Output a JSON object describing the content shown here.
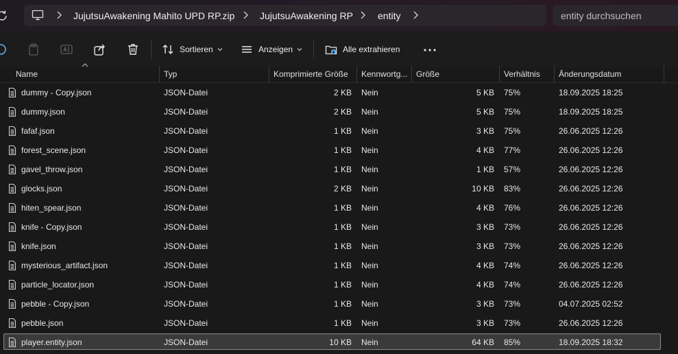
{
  "breadcrumb": {
    "items": [
      "JujutsuAwakening Mahito UPD RP.zip",
      "JujutsuAwakening RP",
      "entity"
    ]
  },
  "search": {
    "placeholder": "entity durchsuchen"
  },
  "toolbar": {
    "sort_label": "Sortieren",
    "view_label": "Anzeigen",
    "extract_label": "Alle extrahieren"
  },
  "columns": [
    "Name",
    "Typ",
    "Komprimierte Größe",
    "Kennwortg...",
    "Größe",
    "Verhältnis",
    "Änderungsdatum"
  ],
  "files": [
    {
      "name": "dummy - Copy.json",
      "type": "JSON-Datei",
      "compressed": "2 KB",
      "password": "Nein",
      "size": "5 KB",
      "ratio": "75%",
      "modified": "18.09.2025 18:25"
    },
    {
      "name": "dummy.json",
      "type": "JSON-Datei",
      "compressed": "2 KB",
      "password": "Nein",
      "size": "5 KB",
      "ratio": "75%",
      "modified": "18.09.2025 18:25"
    },
    {
      "name": "fafaf.json",
      "type": "JSON-Datei",
      "compressed": "1 KB",
      "password": "Nein",
      "size": "3 KB",
      "ratio": "75%",
      "modified": "26.06.2025 12:26"
    },
    {
      "name": "forest_scene.json",
      "type": "JSON-Datei",
      "compressed": "1 KB",
      "password": "Nein",
      "size": "4 KB",
      "ratio": "77%",
      "modified": "26.06.2025 12:26"
    },
    {
      "name": "gavel_throw.json",
      "type": "JSON-Datei",
      "compressed": "1 KB",
      "password": "Nein",
      "size": "1 KB",
      "ratio": "57%",
      "modified": "26.06.2025 12:26"
    },
    {
      "name": "glocks.json",
      "type": "JSON-Datei",
      "compressed": "2 KB",
      "password": "Nein",
      "size": "10 KB",
      "ratio": "83%",
      "modified": "26.06.2025 12:26"
    },
    {
      "name": "hiten_spear.json",
      "type": "JSON-Datei",
      "compressed": "1 KB",
      "password": "Nein",
      "size": "4 KB",
      "ratio": "76%",
      "modified": "26.06.2025 12:26"
    },
    {
      "name": "knife - Copy.json",
      "type": "JSON-Datei",
      "compressed": "1 KB",
      "password": "Nein",
      "size": "3 KB",
      "ratio": "73%",
      "modified": "26.06.2025 12:26"
    },
    {
      "name": "knife.json",
      "type": "JSON-Datei",
      "compressed": "1 KB",
      "password": "Nein",
      "size": "3 KB",
      "ratio": "73%",
      "modified": "26.06.2025 12:26"
    },
    {
      "name": "mysterious_artifact.json",
      "type": "JSON-Datei",
      "compressed": "1 KB",
      "password": "Nein",
      "size": "4 KB",
      "ratio": "74%",
      "modified": "26.06.2025 12:26"
    },
    {
      "name": "particle_locator.json",
      "type": "JSON-Datei",
      "compressed": "1 KB",
      "password": "Nein",
      "size": "4 KB",
      "ratio": "74%",
      "modified": "26.06.2025 12:26"
    },
    {
      "name": "pebble - Copy.json",
      "type": "JSON-Datei",
      "compressed": "1 KB",
      "password": "Nein",
      "size": "3 KB",
      "ratio": "73%",
      "modified": "04.07.2025 02:52"
    },
    {
      "name": "pebble.json",
      "type": "JSON-Datei",
      "compressed": "1 KB",
      "password": "Nein",
      "size": "3 KB",
      "ratio": "73%",
      "modified": "26.06.2025 12:26"
    },
    {
      "name": "player.entity.json",
      "type": "JSON-Datei",
      "compressed": "10 KB",
      "password": "Nein",
      "size": "64 KB",
      "ratio": "85%",
      "modified": "18.09.2025 18:32",
      "selected": true
    }
  ]
}
